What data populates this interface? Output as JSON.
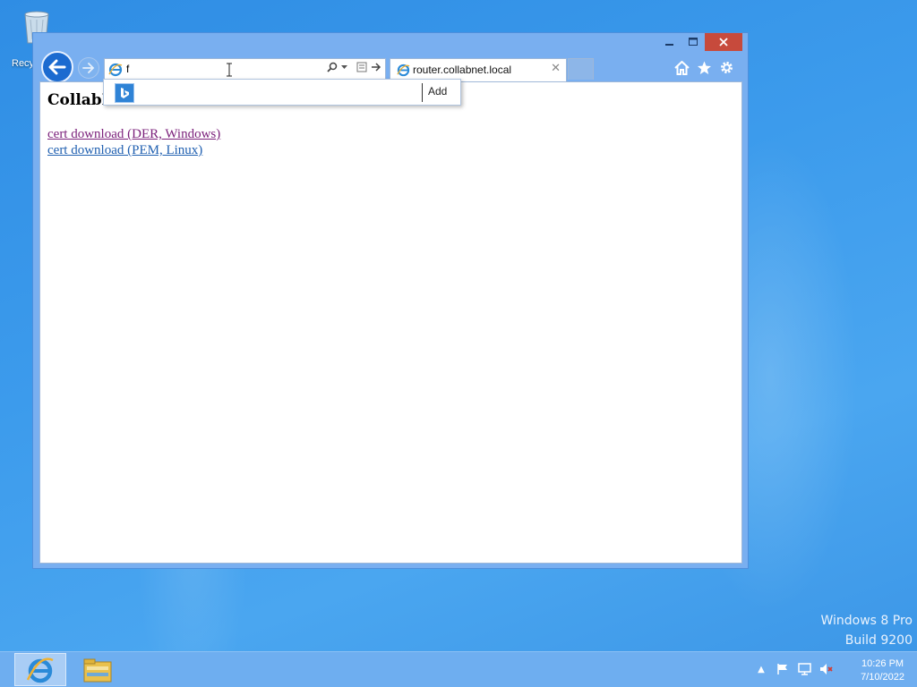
{
  "desktop": {
    "recycle_bin_label": "Recycle Bin",
    "watermark_line1": "Windows 8 Pro",
    "watermark_line2": "Build 9200"
  },
  "browser": {
    "address_value": "f",
    "tab_title": "router.collabnet.local",
    "autocomplete": {
      "add_label": "Add"
    },
    "window_controls": {
      "minimize": "–",
      "maximize": "□",
      "close": "✕"
    },
    "tab_close": "✕"
  },
  "page": {
    "heading": "CollabN",
    "links": [
      {
        "text": "cert download (DER, Windows)",
        "visited": true
      },
      {
        "text": "cert download (PEM, Linux)",
        "visited": false
      }
    ]
  },
  "taskbar": {
    "time": "10:26 PM",
    "date": "7/10/2022",
    "tray_expand": "▲"
  },
  "colors": {
    "desktop_blue": "#3c9bec",
    "visited_link": "#7a1f7a",
    "link": "#1f5fb0",
    "close_button": "#c74a3c",
    "back_button": "#1c6bd0"
  },
  "icons": [
    "recycle-bin-icon",
    "back-arrow-icon",
    "forward-arrow-icon",
    "ie-icon",
    "search-icon",
    "compatibility-icon",
    "go-arrow-icon",
    "home-icon",
    "favorites-star-icon",
    "gear-icon",
    "bing-icon",
    "file-explorer-icon",
    "flag-icon",
    "network-icon",
    "speaker-muted-icon"
  ]
}
